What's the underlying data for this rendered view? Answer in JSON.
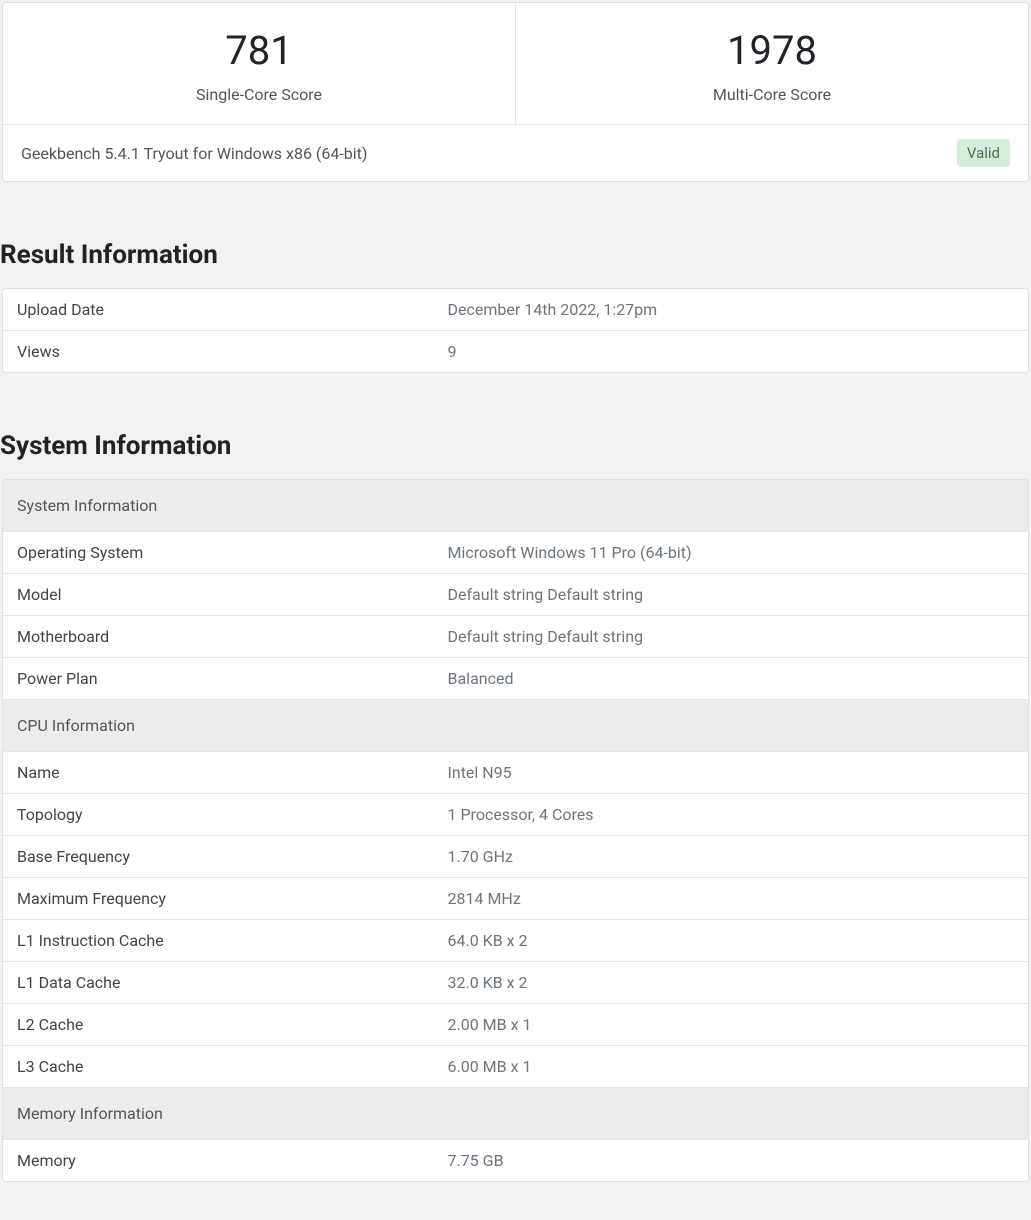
{
  "scores": {
    "single_core": {
      "value": "781",
      "label": "Single-Core Score"
    },
    "multi_core": {
      "value": "1978",
      "label": "Multi-Core Score"
    }
  },
  "footer": {
    "version": "Geekbench 5.4.1 Tryout for Windows x86 (64-bit)",
    "status": "Valid"
  },
  "result_info": {
    "title": "Result Information",
    "rows": [
      {
        "name": "Upload Date",
        "value": "December 14th 2022, 1:27pm"
      },
      {
        "name": "Views",
        "value": "9"
      }
    ]
  },
  "system_info": {
    "title": "System Information",
    "sections": [
      {
        "header": "System Information",
        "rows": [
          {
            "name": "Operating System",
            "value": "Microsoft Windows 11 Pro (64-bit)"
          },
          {
            "name": "Model",
            "value": "Default string Default string"
          },
          {
            "name": "Motherboard",
            "value": "Default string Default string"
          },
          {
            "name": "Power Plan",
            "value": "Balanced"
          }
        ]
      },
      {
        "header": "CPU Information",
        "rows": [
          {
            "name": "Name",
            "value": "Intel N95"
          },
          {
            "name": "Topology",
            "value": "1 Processor, 4 Cores"
          },
          {
            "name": "Base Frequency",
            "value": "1.70 GHz"
          },
          {
            "name": "Maximum Frequency",
            "value": "2814 MHz"
          },
          {
            "name": "L1 Instruction Cache",
            "value": "64.0 KB x 2"
          },
          {
            "name": "L1 Data Cache",
            "value": "32.0 KB x 2"
          },
          {
            "name": "L2 Cache",
            "value": "2.00 MB x 1"
          },
          {
            "name": "L3 Cache",
            "value": "6.00 MB x 1"
          }
        ]
      },
      {
        "header": "Memory Information",
        "rows": [
          {
            "name": "Memory",
            "value": "7.75 GB"
          }
        ]
      }
    ]
  }
}
